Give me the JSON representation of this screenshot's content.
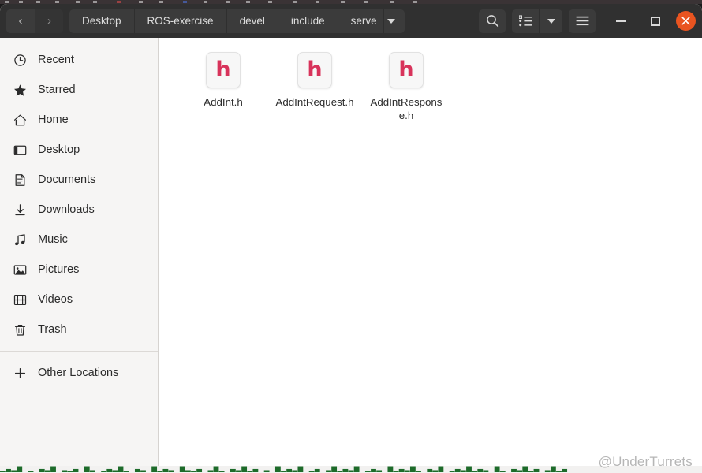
{
  "window": {
    "title": "serve",
    "close_label": "✕"
  },
  "nav": {
    "back_label": "‹",
    "forward_label": "›"
  },
  "breadcrumb": {
    "items": [
      {
        "label": "Desktop"
      },
      {
        "label": "ROS-exercise"
      },
      {
        "label": "devel"
      },
      {
        "label": "include"
      },
      {
        "label": "serve"
      }
    ],
    "caret_icon": "chevron-down-icon"
  },
  "toolbar": {
    "search_icon": "search-icon",
    "view_list_icon": "list-view-icon",
    "view_caret_icon": "chevron-down-icon",
    "menu_icon": "hamburger-menu-icon",
    "minimize_icon": "minimize-icon",
    "maximize_icon": "maximize-icon",
    "close_icon": "close-icon"
  },
  "sidebar": {
    "items": [
      {
        "label": "Recent",
        "icon": "clock-icon"
      },
      {
        "label": "Starred",
        "icon": "star-icon"
      },
      {
        "label": "Home",
        "icon": "home-icon"
      },
      {
        "label": "Desktop",
        "icon": "desktop-icon"
      },
      {
        "label": "Documents",
        "icon": "document-icon"
      },
      {
        "label": "Downloads",
        "icon": "download-arrow-icon"
      },
      {
        "label": "Music",
        "icon": "music-note-icon"
      },
      {
        "label": "Pictures",
        "icon": "picture-icon"
      },
      {
        "label": "Videos",
        "icon": "film-icon"
      },
      {
        "label": "Trash",
        "icon": "trash-icon"
      }
    ],
    "other_locations": {
      "label": "Other Locations",
      "icon": "plus-icon"
    }
  },
  "files": [
    {
      "name": "AddInt.h",
      "type": "h",
      "glyph": "h"
    },
    {
      "name": "AddIntRequest.h",
      "type": "h",
      "glyph": "h"
    },
    {
      "name": "AddIntResponse.h",
      "type": "h",
      "glyph": "h"
    }
  ],
  "watermark": {
    "text": "@UnderTurrets"
  },
  "background": {
    "terminal_text": "▁▃▂▅ ▁ ▃▂▅ ▂▁▃ ▅▂ ▁▃▂▅▁ ▃▂ ▅▁▃▂ ▅▂▁▃ ▂▅▁ ▃▂▅▁▃ ▂ ▅▁▃▂▅ ▁▃ ▂▅▁▃▂▅ ▁▃▂ ▅▁▃▂▅▁ ▃▂▅ ▁▃▂▅▁▃▂ ▅▁ ▃▂▅▁▃ ▂▅▁▃"
  }
}
